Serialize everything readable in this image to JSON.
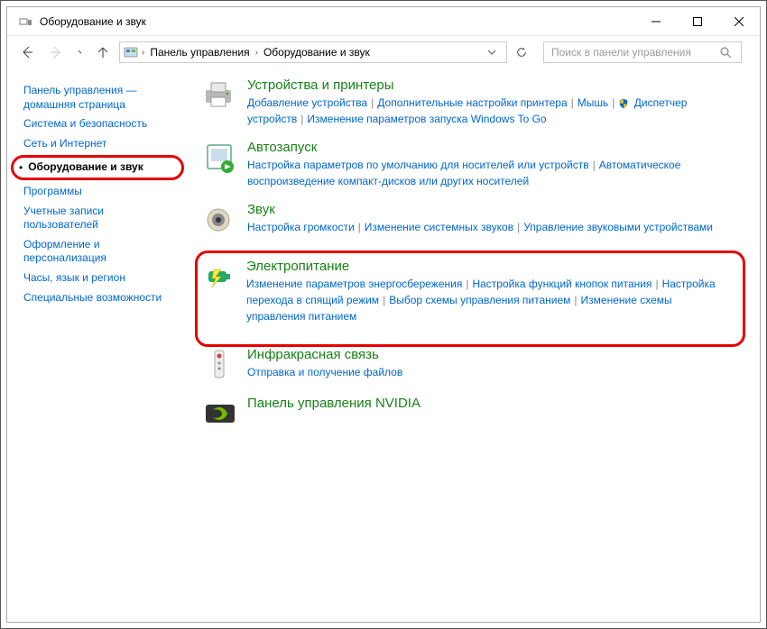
{
  "window": {
    "title": "Оборудование и звук"
  },
  "breadcrumb": {
    "root": "Панель управления",
    "current": "Оборудование и звук"
  },
  "search": {
    "placeholder": "Поиск в панели управления"
  },
  "sidebar": [
    {
      "label": "Панель управления — домашняя страница",
      "active": false
    },
    {
      "label": "Система и безопасность",
      "active": false
    },
    {
      "label": "Сеть и Интернет",
      "active": false
    },
    {
      "label": "Оборудование и звук",
      "active": true
    },
    {
      "label": "Программы",
      "active": false
    },
    {
      "label": "Учетные записи пользователей",
      "active": false
    },
    {
      "label": "Оформление и персонализация",
      "active": false
    },
    {
      "label": "Часы, язык и регион",
      "active": false
    },
    {
      "label": "Специальные возможности",
      "active": false
    }
  ],
  "categories": [
    {
      "title": "Устройства и принтеры",
      "icon": "printer",
      "highlight": false,
      "links": [
        {
          "text": "Добавление устройства",
          "shield": false
        },
        {
          "text": "Дополнительные настройки принтера",
          "shield": false
        },
        {
          "text": "Мышь",
          "shield": false
        },
        {
          "text": "Диспетчер устройств",
          "shield": true
        },
        {
          "text": "Изменение параметров запуска Windows To Go",
          "shield": false
        }
      ]
    },
    {
      "title": "Автозапуск",
      "icon": "autoplay",
      "highlight": false,
      "links": [
        {
          "text": "Настройка параметров по умолчанию для носителей или устройств",
          "shield": false
        },
        {
          "text": "Автоматическое воспроизведение компакт-дисков или других носителей",
          "shield": false
        }
      ]
    },
    {
      "title": "Звук",
      "icon": "sound",
      "highlight": false,
      "links": [
        {
          "text": "Настройка громкости",
          "shield": false
        },
        {
          "text": "Изменение системных звуков",
          "shield": false
        },
        {
          "text": "Управление звуковыми устройствами",
          "shield": false
        }
      ]
    },
    {
      "title": "Электропитание",
      "icon": "power",
      "highlight": true,
      "links": [
        {
          "text": "Изменение параметров энергосбережения",
          "shield": false
        },
        {
          "text": "Настройка функций кнопок питания",
          "shield": false
        },
        {
          "text": "Настройка перехода в спящий режим",
          "shield": false
        },
        {
          "text": "Выбор схемы управления питанием",
          "shield": false
        },
        {
          "text": "Изменение схемы управления питанием",
          "shield": false
        }
      ]
    },
    {
      "title": "Инфракрасная связь",
      "icon": "infrared",
      "highlight": false,
      "links": [
        {
          "text": "Отправка и получение файлов",
          "shield": false
        }
      ]
    },
    {
      "title": "Панель управления NVIDIA",
      "icon": "nvidia",
      "highlight": false,
      "links": []
    }
  ]
}
